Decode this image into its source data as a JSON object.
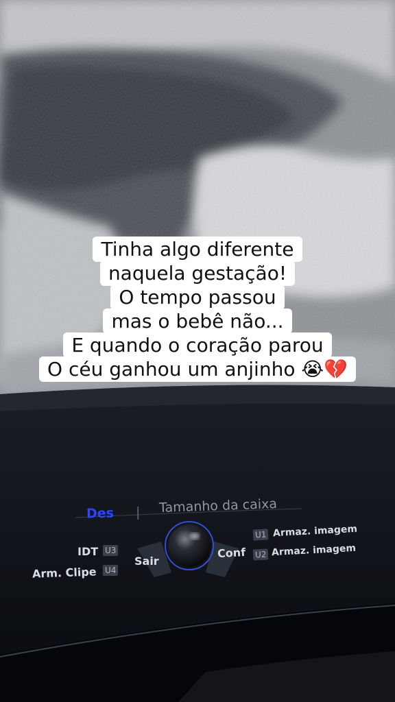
{
  "caption": {
    "lines": [
      "Tinha algo diferente",
      "naquela gestação!",
      "O tempo passou",
      "mas o bebê não...",
      "E quando o coração parou",
      "O céu ganhou um anjinho 😭💔"
    ]
  },
  "ultrasound_ui": {
    "mode_label": "Des",
    "separator": "|",
    "box_size_label": "Tamanho da caixa",
    "left_keys": [
      {
        "label": "IDT",
        "key": "U3"
      },
      {
        "label": "Arm. Clipe",
        "key": "U4"
      }
    ],
    "exit_label": "Sair",
    "confirm_label": "Conf",
    "right_keys": [
      {
        "key": "U1",
        "label": "Armaz. imagem"
      },
      {
        "key": "U2",
        "label": "Armaz. imagem"
      }
    ]
  },
  "colors": {
    "caption_bg": "#ffffff",
    "caption_text": "#111111",
    "mode_label": "#2c43ff"
  }
}
